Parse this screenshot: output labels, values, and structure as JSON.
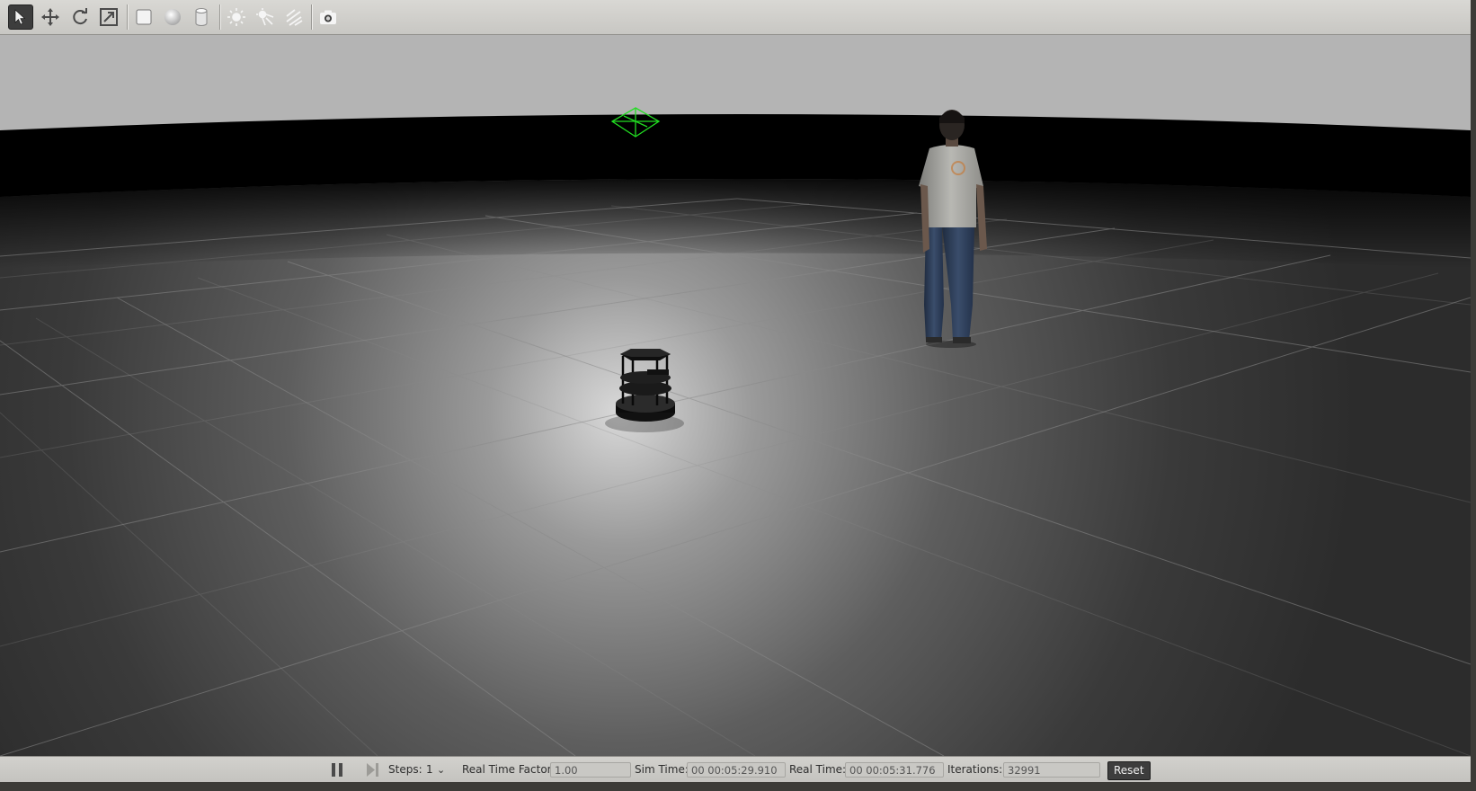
{
  "toolbar": {
    "tools": [
      {
        "icon": "select-arrow-icon",
        "active": true
      },
      {
        "icon": "translate-icon"
      },
      {
        "icon": "rotate-icon"
      },
      {
        "icon": "scale-icon"
      },
      {
        "icon": "box-shape-icon"
      },
      {
        "icon": "sphere-shape-icon"
      },
      {
        "icon": "cylinder-shape-icon"
      },
      {
        "icon": "point-light-icon"
      },
      {
        "icon": "spot-light-icon"
      },
      {
        "icon": "directional-light-icon"
      },
      {
        "icon": "screenshot-camera-icon"
      }
    ]
  },
  "scene": {
    "sky_color": "#b4b4b4",
    "ground_color": "#1b1b1b",
    "light_marker_color": "#22dd22",
    "objects": [
      "turtlebot-robot",
      "standing-person",
      "sun-light-marker"
    ]
  },
  "time_panel": {
    "steps_label": "Steps:",
    "steps_value": "1",
    "real_time_factor_label": "Real Time Factor:",
    "real_time_factor_value": "1.00",
    "sim_time_label": "Sim Time:",
    "sim_time_value": "00 00:05:29.910",
    "real_time_label": "Real Time:",
    "real_time_value": "00 00:05:31.776",
    "iterations_label": "Iterations:",
    "iterations_value": "32991",
    "reset_label": "Reset"
  }
}
